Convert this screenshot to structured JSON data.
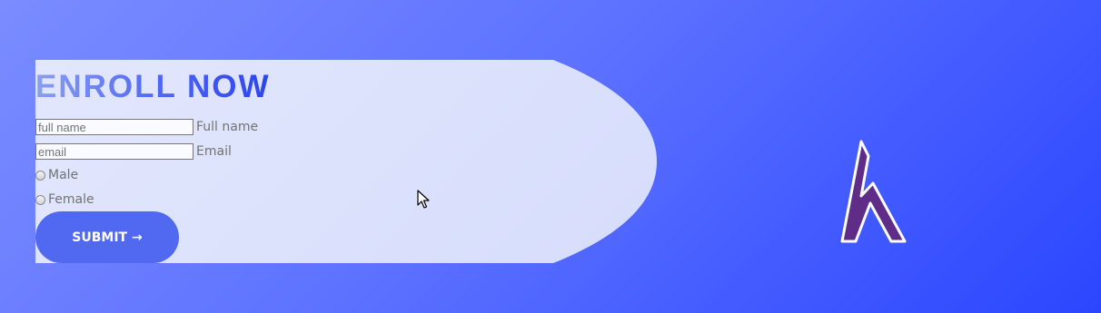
{
  "form": {
    "title": "ENROLL NOW",
    "full_name": {
      "placeholder": "full name",
      "label": "Full name"
    },
    "email": {
      "placeholder": "email",
      "label": "Email"
    },
    "gender_options": [
      {
        "label": "Male"
      },
      {
        "label": "Female"
      }
    ],
    "submit_label": "SUBMIT →"
  },
  "logo": {
    "icon": "h-letter-logo-icon",
    "color": "#5f2d87"
  },
  "cursor": {
    "icon": "mouse-pointer-icon"
  },
  "colors": {
    "background_start": "#7b8cff",
    "background_end": "#2b46ff",
    "card": "#dde3fc",
    "accent": "#5168f1",
    "title_start": "#8a9ef2",
    "title_end": "#2b44ee",
    "label_text": "#737373"
  }
}
